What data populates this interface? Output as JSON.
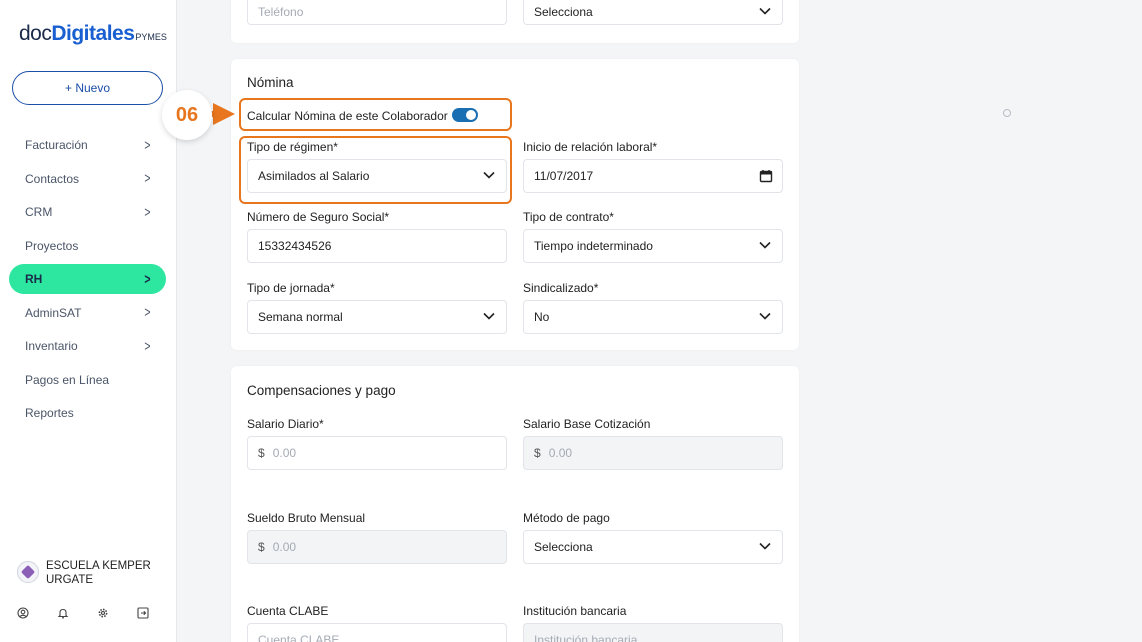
{
  "sidebar": {
    "logo": {
      "doc": "doc",
      "digitales": "Digitales",
      "pymes": "PYMES"
    },
    "new_button": "+ Nuevo",
    "items": [
      {
        "label": "Facturación",
        "chevron": true
      },
      {
        "label": "Contactos",
        "chevron": true
      },
      {
        "label": "CRM",
        "chevron": true
      },
      {
        "label": "Proyectos",
        "chevron": false
      },
      {
        "label": "RH",
        "chevron": true,
        "active": true
      },
      {
        "label": "AdminSAT",
        "chevron": true
      },
      {
        "label": "Inventario",
        "chevron": true
      },
      {
        "label": "Pagos en Línea",
        "chevron": false
      },
      {
        "label": "Reportes",
        "chevron": false
      }
    ],
    "company": "ESCUELA KEMPER URGATE"
  },
  "top_card": {
    "phone_placeholder": "Teléfono",
    "select_value": "Selecciona"
  },
  "nomina": {
    "title": "Nómina",
    "calc_toggle_label": "Calcular Nómina de este Colaborador",
    "calc_toggle_on": true,
    "regimen_label": "Tipo de régimen*",
    "regimen_value": "Asimilados al Salario",
    "inicio_label": "Inicio de relación laboral*",
    "inicio_value": "11/07/2017",
    "nss_label": "Número de Seguro Social*",
    "nss_value": "15332434526",
    "contrato_label": "Tipo de contrato*",
    "contrato_value": "Tiempo indeterminado",
    "jornada_label": "Tipo de jornada*",
    "jornada_value": "Semana normal",
    "sindicalizado_label": "Sindicalizado*",
    "sindicalizado_value": "No"
  },
  "compensaciones": {
    "title": "Compensaciones y pago",
    "salario_diario_label": "Salario Diario*",
    "salario_diario_placeholder": "0.00",
    "salario_base_label": "Salario Base Cotización",
    "salario_base_placeholder": "0.00",
    "sueldo_bruto_label": "Sueldo Bruto Mensual",
    "sueldo_bruto_placeholder": "0.00",
    "metodo_label": "Método de pago",
    "metodo_value": "Selecciona",
    "clabe_label": "Cuenta CLABE",
    "clabe_placeholder": "Cuenta CLABE",
    "institucion_label": "Institución bancaria",
    "institucion_placeholder": "Institución bancaria",
    "currency": "$"
  },
  "annotation": {
    "step": "06",
    "color": "#e7761f"
  },
  "colors": {
    "active_nav": "#2de6a0",
    "brand_blue": "#1a5fd1",
    "toggle": "#1a6fb3"
  }
}
